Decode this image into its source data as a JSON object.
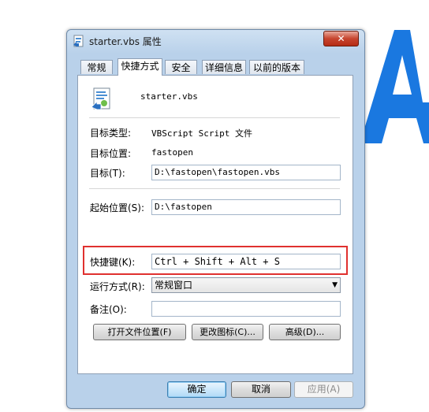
{
  "window": {
    "title": "starter.vbs 属性",
    "close_symbol": "✕"
  },
  "tabs": [
    {
      "label": "常规"
    },
    {
      "label": "快捷方式",
      "active": true
    },
    {
      "label": "安全"
    },
    {
      "label": "详细信息"
    },
    {
      "label": "以前的版本"
    }
  ],
  "file": {
    "name": "starter.vbs"
  },
  "props": {
    "type_label": "目标类型:",
    "type_value": "VBScript Script 文件",
    "location_label": "目标位置:",
    "location_value": "fastopen",
    "target_label": "目标(T):",
    "target_value": "D:\\fastopen\\fastopen.vbs",
    "start_label": "起始位置(S):",
    "start_value": "D:\\fastopen",
    "hotkey_label": "快捷键(K):",
    "hotkey_value": "Ctrl + Shift + Alt + S",
    "run_label": "运行方式(R):",
    "run_value": "常规窗口",
    "comment_label": "备注(O):",
    "comment_value": ""
  },
  "actions": {
    "open_location": "打开文件位置(F)",
    "change_icon": "更改图标(C)...",
    "advanced": "高级(D)..."
  },
  "footer": {
    "ok": "确定",
    "cancel": "取消",
    "apply": "应用(A)"
  },
  "colors": {
    "highlight_border": "#e0312f",
    "background_letter": "#1a78e0"
  },
  "background": {
    "partial_letter": "A"
  }
}
